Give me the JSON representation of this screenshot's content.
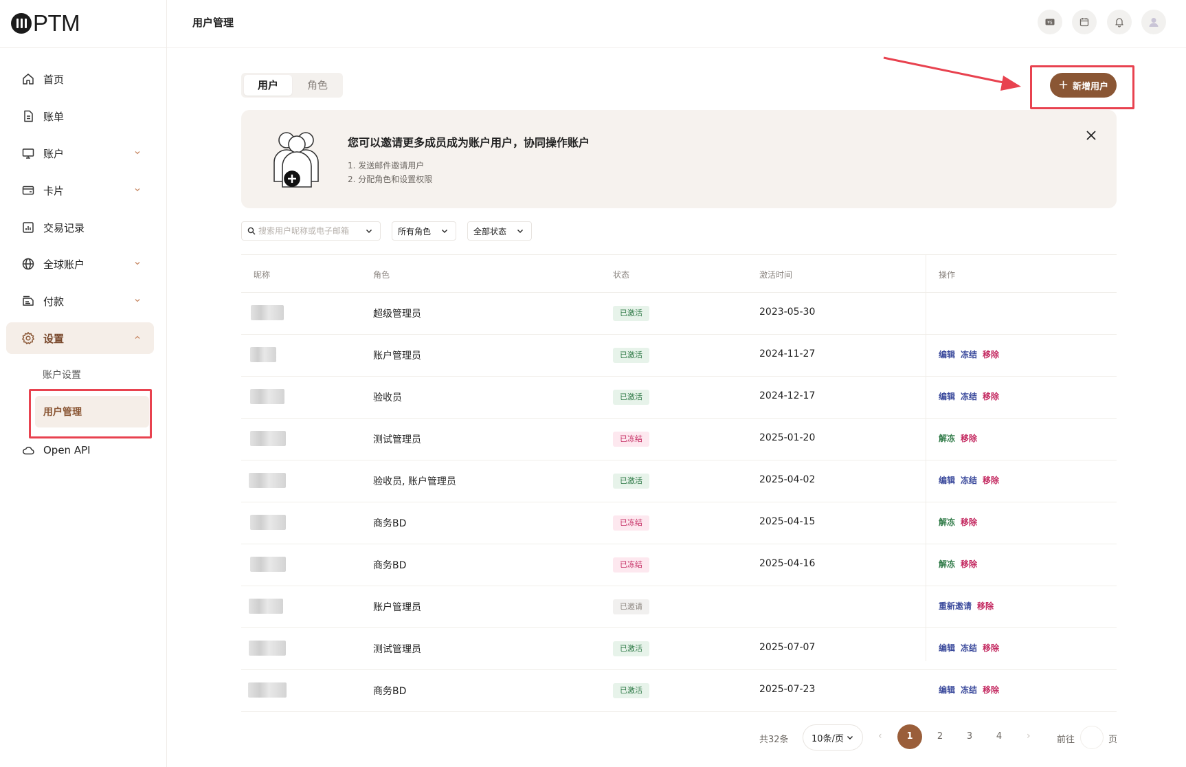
{
  "app": {
    "logo_text": "PTM"
  },
  "sidebar": {
    "items": [
      {
        "label": "首页",
        "icon": "home-icon"
      },
      {
        "label": "账单",
        "icon": "bill-icon"
      },
      {
        "label": "账户",
        "icon": "monitor-icon",
        "expandable": true
      },
      {
        "label": "卡片",
        "icon": "card-icon",
        "expandable": true
      },
      {
        "label": "交易记录",
        "icon": "chart-icon"
      },
      {
        "label": "全球账户",
        "icon": "globe-icon",
        "expandable": true
      },
      {
        "label": "付款",
        "icon": "payment-icon",
        "expandable": true
      },
      {
        "label": "设置",
        "icon": "gear-icon",
        "expandable": true,
        "expanded": true,
        "active": true
      },
      {
        "label": "Open API",
        "icon": "cloud-icon"
      }
    ],
    "settings_sub": [
      {
        "label": "账户设置"
      },
      {
        "label": "用户管理",
        "active": true
      }
    ]
  },
  "header": {
    "title": "用户管理"
  },
  "tabs": [
    {
      "label": "用户",
      "active": true
    },
    {
      "label": "角色",
      "active": false
    }
  ],
  "add_user_button": {
    "label": "新增用户"
  },
  "banner": {
    "title": "您可以邀请更多成员成为账户用户，协同操作账户",
    "line1": "1. 发送邮件邀请用户",
    "line2": "2. 分配角色和设置权限"
  },
  "filters": {
    "search_placeholder": "搜索用户昵称或电子邮箱",
    "role": "所有角色",
    "status": "全部状态"
  },
  "table": {
    "columns": [
      "昵称",
      "角色",
      "状态",
      "激活时间",
      "操作"
    ],
    "rows": [
      {
        "role": "超级管理员",
        "status": "已激活",
        "status_type": "active",
        "time": "2023-05-30",
        "ops": []
      },
      {
        "role": "账户管理员",
        "status": "已激活",
        "status_type": "active",
        "time": "2024-11-27",
        "ops": [
          "编辑",
          "冻结",
          "移除"
        ]
      },
      {
        "role": "验收员",
        "status": "已激活",
        "status_type": "active",
        "time": "2024-12-17",
        "ops": [
          "编辑",
          "冻结",
          "移除"
        ]
      },
      {
        "role": "测试管理员",
        "status": "已冻结",
        "status_type": "frozen",
        "time": "2025-01-20",
        "ops": [
          "解冻",
          "移除"
        ]
      },
      {
        "role": "验收员, 账户管理员",
        "status": "已激活",
        "status_type": "active",
        "time": "2025-04-02",
        "ops": [
          "编辑",
          "冻结",
          "移除"
        ]
      },
      {
        "role": "商务BD",
        "status": "已冻结",
        "status_type": "frozen",
        "time": "2025-04-15",
        "ops": [
          "解冻",
          "移除"
        ]
      },
      {
        "role": "商务BD",
        "status": "已冻结",
        "status_type": "frozen",
        "time": "2025-04-16",
        "ops": [
          "解冻",
          "移除"
        ]
      },
      {
        "role": "账户管理员",
        "status": "已邀请",
        "status_type": "invited",
        "time": "",
        "ops": [
          "重新邀请",
          "移除"
        ]
      },
      {
        "role": "测试管理员",
        "status": "已激活",
        "status_type": "active",
        "time": "2025-07-07",
        "ops": [
          "编辑",
          "冻结",
          "移除"
        ]
      },
      {
        "role": "商务BD",
        "status": "已激活",
        "status_type": "active",
        "time": "2025-07-23",
        "ops": [
          "编辑",
          "冻结",
          "移除"
        ]
      }
    ]
  },
  "pagination": {
    "total": "共32条",
    "page_size": "10条/页",
    "pages": [
      "1",
      "2",
      "3",
      "4"
    ],
    "current": "1",
    "goto_label": "前往",
    "page_word": "页"
  },
  "colors": {
    "brand": "#8a5634",
    "active_bg": "#f5eee8",
    "highlight_red": "#e8424f",
    "status_active": "#2f7a47",
    "status_frozen": "#c42a61",
    "op_blue": "#3b4a9c"
  }
}
